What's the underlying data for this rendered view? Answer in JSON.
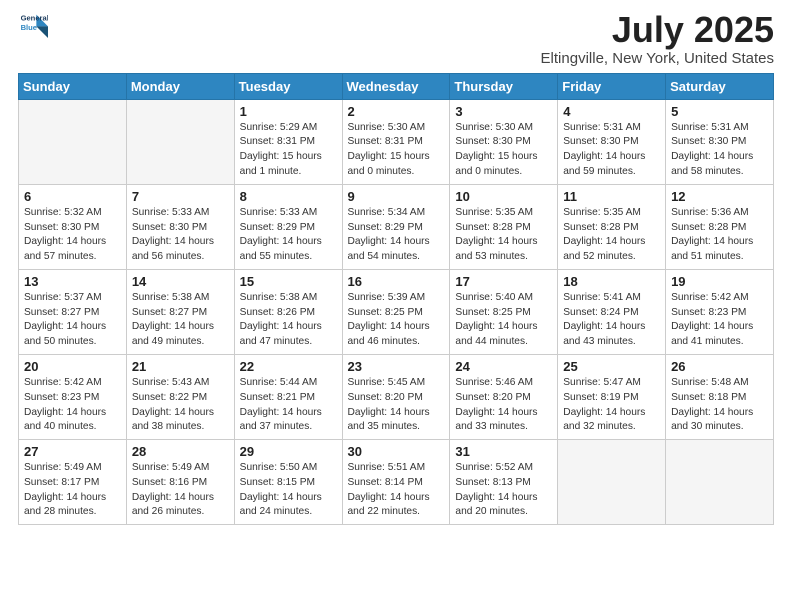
{
  "logo": {
    "line1": "General",
    "line2": "Blue"
  },
  "title": "July 2025",
  "subtitle": "Eltingville, New York, United States",
  "days_of_week": [
    "Sunday",
    "Monday",
    "Tuesday",
    "Wednesday",
    "Thursday",
    "Friday",
    "Saturday"
  ],
  "weeks": [
    [
      {
        "day": "",
        "info": ""
      },
      {
        "day": "",
        "info": ""
      },
      {
        "day": "1",
        "info": "Sunrise: 5:29 AM\nSunset: 8:31 PM\nDaylight: 15 hours and 1 minute."
      },
      {
        "day": "2",
        "info": "Sunrise: 5:30 AM\nSunset: 8:31 PM\nDaylight: 15 hours and 0 minutes."
      },
      {
        "day": "3",
        "info": "Sunrise: 5:30 AM\nSunset: 8:30 PM\nDaylight: 15 hours and 0 minutes."
      },
      {
        "day": "4",
        "info": "Sunrise: 5:31 AM\nSunset: 8:30 PM\nDaylight: 14 hours and 59 minutes."
      },
      {
        "day": "5",
        "info": "Sunrise: 5:31 AM\nSunset: 8:30 PM\nDaylight: 14 hours and 58 minutes."
      }
    ],
    [
      {
        "day": "6",
        "info": "Sunrise: 5:32 AM\nSunset: 8:30 PM\nDaylight: 14 hours and 57 minutes."
      },
      {
        "day": "7",
        "info": "Sunrise: 5:33 AM\nSunset: 8:30 PM\nDaylight: 14 hours and 56 minutes."
      },
      {
        "day": "8",
        "info": "Sunrise: 5:33 AM\nSunset: 8:29 PM\nDaylight: 14 hours and 55 minutes."
      },
      {
        "day": "9",
        "info": "Sunrise: 5:34 AM\nSunset: 8:29 PM\nDaylight: 14 hours and 54 minutes."
      },
      {
        "day": "10",
        "info": "Sunrise: 5:35 AM\nSunset: 8:28 PM\nDaylight: 14 hours and 53 minutes."
      },
      {
        "day": "11",
        "info": "Sunrise: 5:35 AM\nSunset: 8:28 PM\nDaylight: 14 hours and 52 minutes."
      },
      {
        "day": "12",
        "info": "Sunrise: 5:36 AM\nSunset: 8:28 PM\nDaylight: 14 hours and 51 minutes."
      }
    ],
    [
      {
        "day": "13",
        "info": "Sunrise: 5:37 AM\nSunset: 8:27 PM\nDaylight: 14 hours and 50 minutes."
      },
      {
        "day": "14",
        "info": "Sunrise: 5:38 AM\nSunset: 8:27 PM\nDaylight: 14 hours and 49 minutes."
      },
      {
        "day": "15",
        "info": "Sunrise: 5:38 AM\nSunset: 8:26 PM\nDaylight: 14 hours and 47 minutes."
      },
      {
        "day": "16",
        "info": "Sunrise: 5:39 AM\nSunset: 8:25 PM\nDaylight: 14 hours and 46 minutes."
      },
      {
        "day": "17",
        "info": "Sunrise: 5:40 AM\nSunset: 8:25 PM\nDaylight: 14 hours and 44 minutes."
      },
      {
        "day": "18",
        "info": "Sunrise: 5:41 AM\nSunset: 8:24 PM\nDaylight: 14 hours and 43 minutes."
      },
      {
        "day": "19",
        "info": "Sunrise: 5:42 AM\nSunset: 8:23 PM\nDaylight: 14 hours and 41 minutes."
      }
    ],
    [
      {
        "day": "20",
        "info": "Sunrise: 5:42 AM\nSunset: 8:23 PM\nDaylight: 14 hours and 40 minutes."
      },
      {
        "day": "21",
        "info": "Sunrise: 5:43 AM\nSunset: 8:22 PM\nDaylight: 14 hours and 38 minutes."
      },
      {
        "day": "22",
        "info": "Sunrise: 5:44 AM\nSunset: 8:21 PM\nDaylight: 14 hours and 37 minutes."
      },
      {
        "day": "23",
        "info": "Sunrise: 5:45 AM\nSunset: 8:20 PM\nDaylight: 14 hours and 35 minutes."
      },
      {
        "day": "24",
        "info": "Sunrise: 5:46 AM\nSunset: 8:20 PM\nDaylight: 14 hours and 33 minutes."
      },
      {
        "day": "25",
        "info": "Sunrise: 5:47 AM\nSunset: 8:19 PM\nDaylight: 14 hours and 32 minutes."
      },
      {
        "day": "26",
        "info": "Sunrise: 5:48 AM\nSunset: 8:18 PM\nDaylight: 14 hours and 30 minutes."
      }
    ],
    [
      {
        "day": "27",
        "info": "Sunrise: 5:49 AM\nSunset: 8:17 PM\nDaylight: 14 hours and 28 minutes."
      },
      {
        "day": "28",
        "info": "Sunrise: 5:49 AM\nSunset: 8:16 PM\nDaylight: 14 hours and 26 minutes."
      },
      {
        "day": "29",
        "info": "Sunrise: 5:50 AM\nSunset: 8:15 PM\nDaylight: 14 hours and 24 minutes."
      },
      {
        "day": "30",
        "info": "Sunrise: 5:51 AM\nSunset: 8:14 PM\nDaylight: 14 hours and 22 minutes."
      },
      {
        "day": "31",
        "info": "Sunrise: 5:52 AM\nSunset: 8:13 PM\nDaylight: 14 hours and 20 minutes."
      },
      {
        "day": "",
        "info": ""
      },
      {
        "day": "",
        "info": ""
      }
    ]
  ]
}
